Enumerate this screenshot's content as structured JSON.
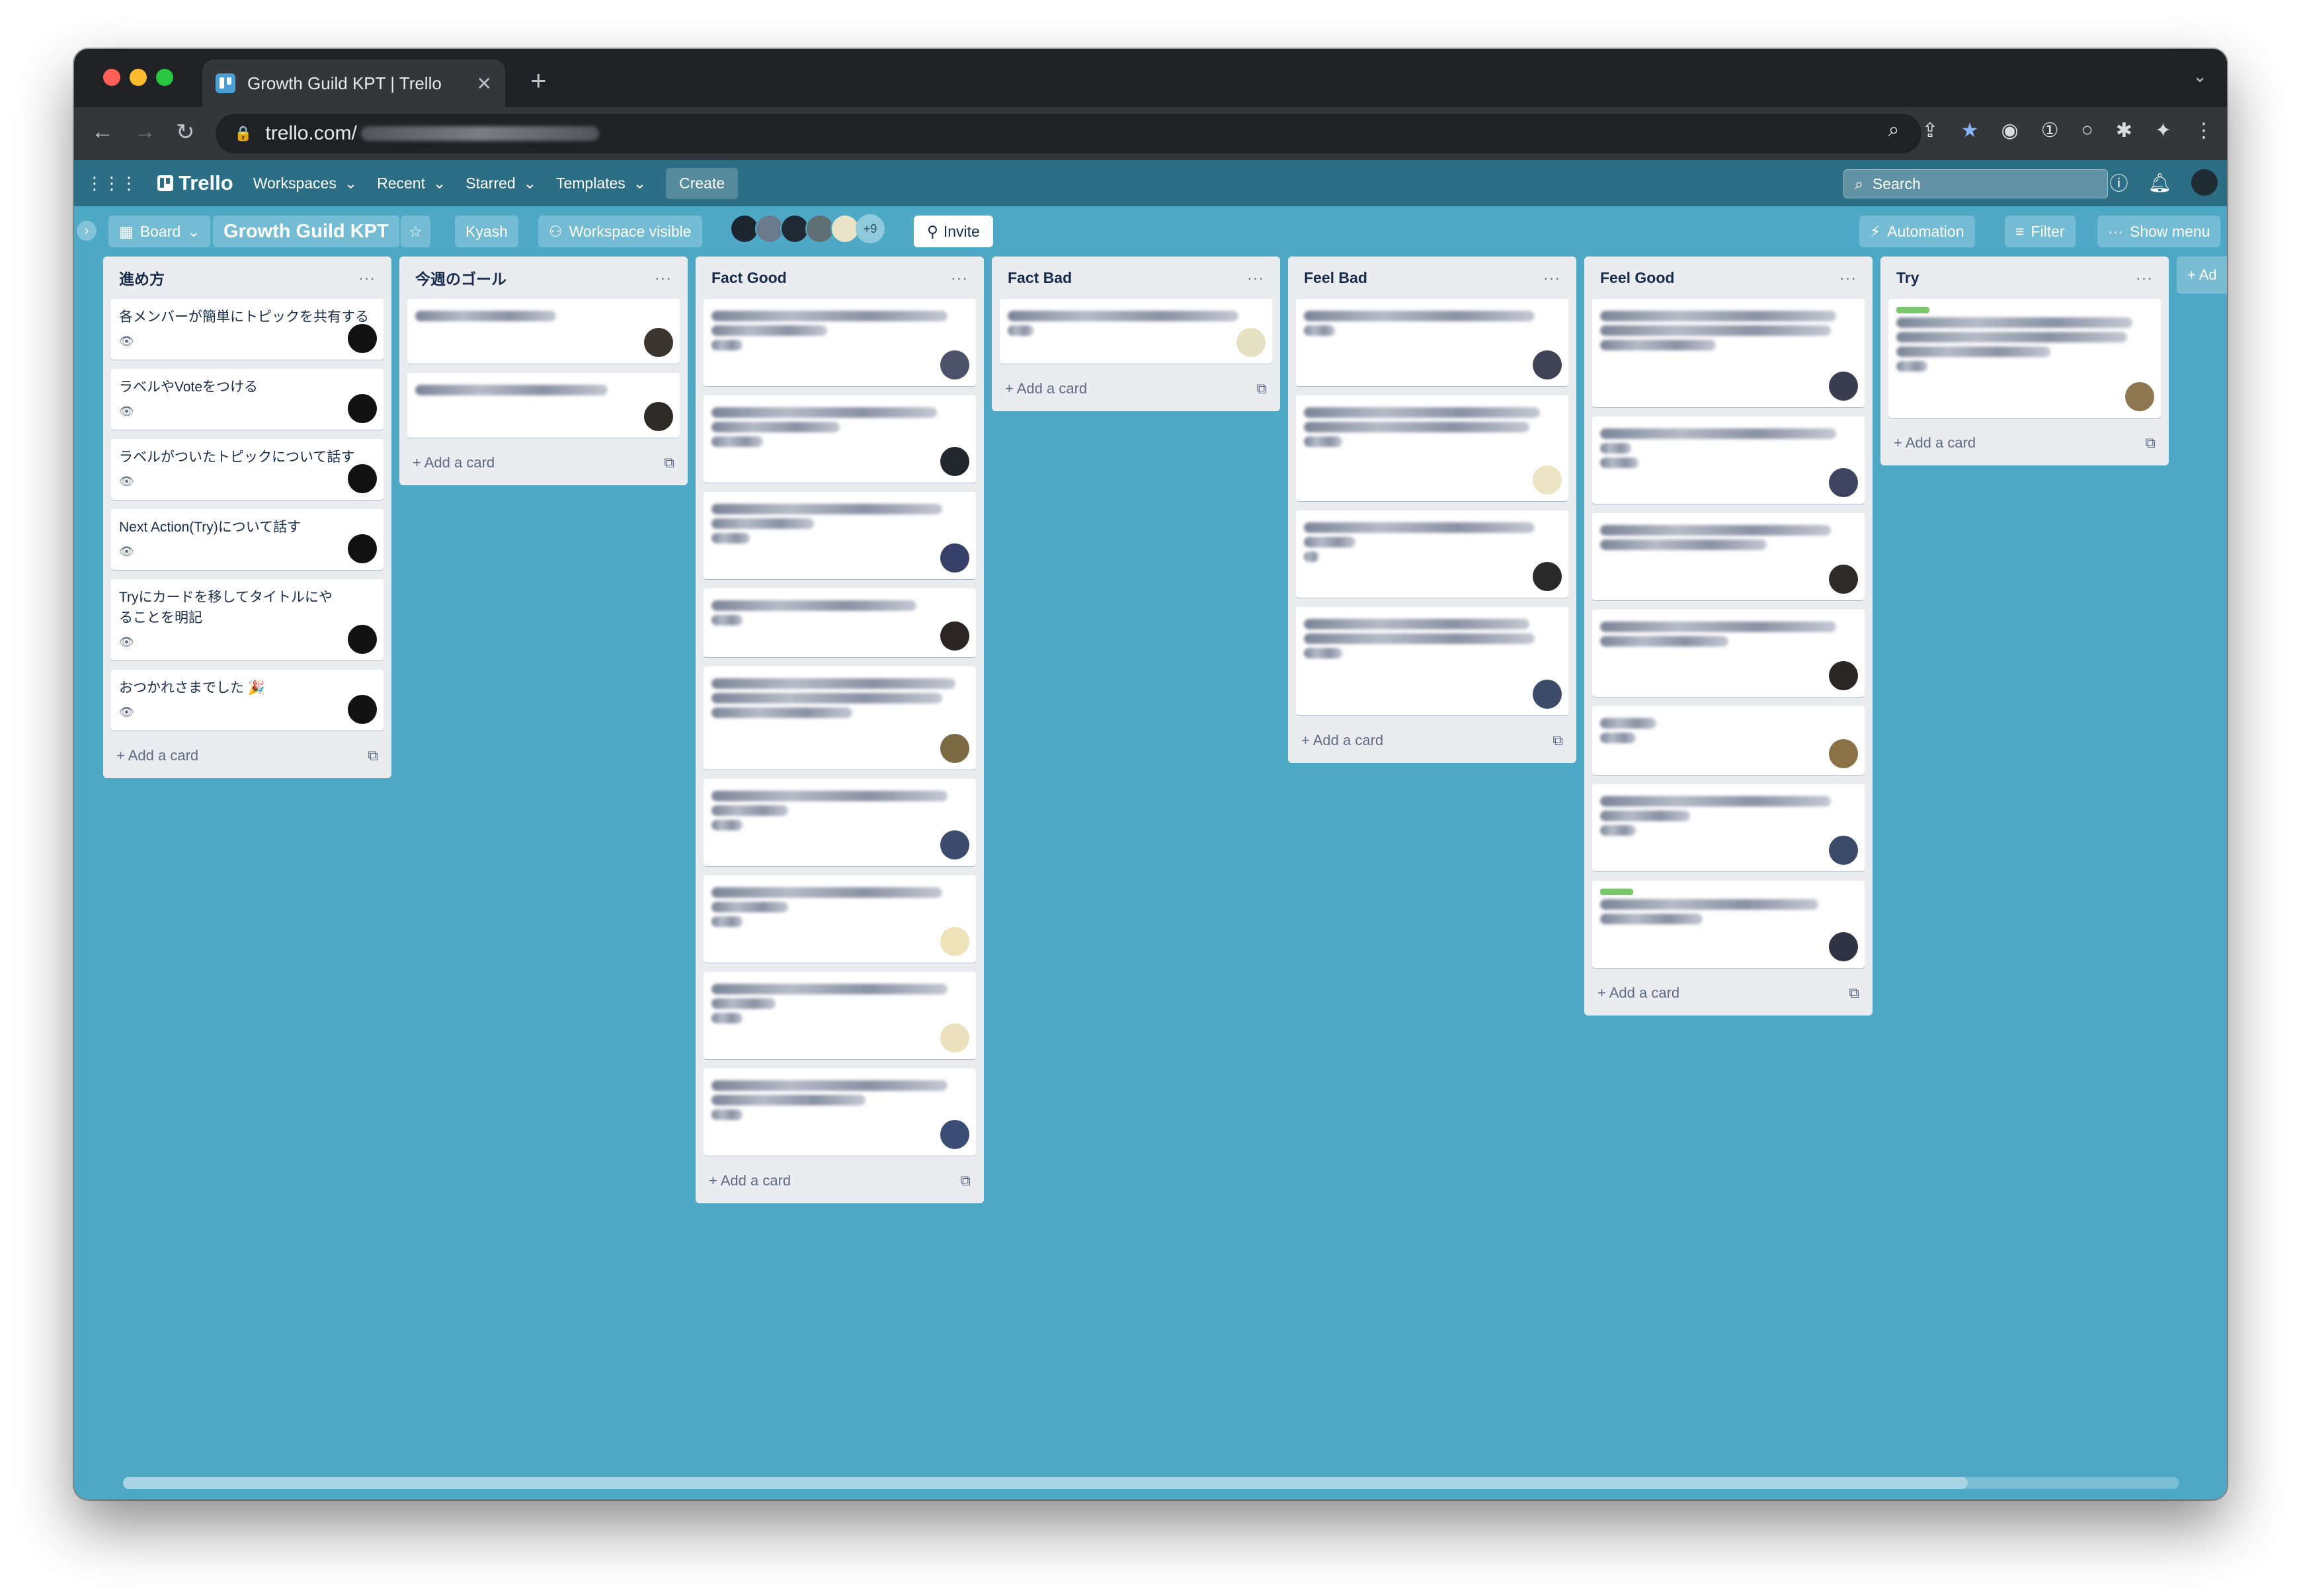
{
  "browser": {
    "tab_title": "Growth Guild KPT | Trello",
    "url": "trello.com/"
  },
  "topnav": {
    "logo": "Trello",
    "workspaces": "Workspaces",
    "recent": "Recent",
    "starred": "Starred",
    "templates": "Templates",
    "create": "Create",
    "search_placeholder": "Search"
  },
  "board": {
    "view": "Board",
    "title": "Growth Guild KPT",
    "workspace": "Kyash",
    "visibility": "Workspace visible",
    "more_members": "+9",
    "invite": "Invite",
    "automation": "Automation",
    "filter": "Filter",
    "show_menu": "Show menu",
    "add_list": "+ Ad"
  },
  "add_card_label": "Add a card",
  "lists": [
    {
      "title": "進め方",
      "cards": [
        "各メンバーが簡単にトピックを共有する",
        "ラベルやVoteをつける",
        "ラベルがついたトピックについて話す",
        "Next Action(Try)について話す",
        "Tryにカードを移してタイトルにやることを明記",
        "おつかれさまでした 🎉"
      ]
    },
    {
      "title": "今週のゴール"
    },
    {
      "title": "Fact Good"
    },
    {
      "title": "Fact Bad"
    },
    {
      "title": "Feel Bad"
    },
    {
      "title": "Feel Good"
    },
    {
      "title": "Try"
    }
  ],
  "colors": {
    "board_bg": "#4ea9c7",
    "header": "#2b6e85",
    "list_bg": "#ebecf0"
  }
}
